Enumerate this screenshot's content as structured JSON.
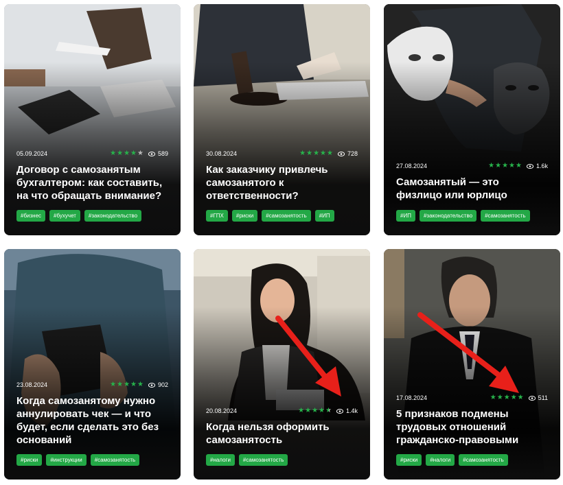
{
  "cards": [
    {
      "date": "05.09.2024",
      "rating": 4,
      "views": "589",
      "title": "Договор с самозанятым бухгалтером: как составить, на что обращать внимание?",
      "tags": [
        "#бизнес",
        "#бухучет",
        "#законодательство"
      ],
      "image": "accountant-calculator-photo"
    },
    {
      "date": "30.08.2024",
      "rating": 5,
      "views": "728",
      "title": "Как заказчику привлечь самозанятого к ответственности?",
      "tags": [
        "#ГПХ",
        "#риски",
        "#самозанятость",
        "#ИП"
      ],
      "image": "judge-gavel-photo"
    },
    {
      "date": "27.08.2024",
      "rating": 5,
      "views": "1.6k",
      "title": "Самозанятый — это физлицо или юрлицо",
      "tags": [
        "#ИП",
        "#законодательство",
        "#самозанятость"
      ],
      "image": "masks-photo"
    },
    {
      "date": "23.08.2024",
      "rating": 5,
      "views": "902",
      "title": "Когда самозанятому нужно аннулировать чек — и что будет, если сделать это без оснований",
      "tags": [
        "#риски",
        "#инструкции",
        "#самозанятость"
      ],
      "image": "phone-hands-photo"
    },
    {
      "date": "20.08.2024",
      "rating": 4.5,
      "views": "1.4k",
      "title": "Когда нельзя оформить самозанятость",
      "tags": [
        "#налоги",
        "#самозанятость"
      ],
      "image": "smiling-woman-photo"
    },
    {
      "date": "17.08.2024",
      "rating": 5,
      "views": "511",
      "title": "5 признаков подмены трудовых отношений гражданско-правовыми",
      "tags": [
        "#риски",
        "#налоги",
        "#самозанятость"
      ],
      "image": "judge-man-photo"
    }
  ],
  "colors": {
    "accent_green": "#23a846",
    "star_green": "#27b34b",
    "arrow_red": "#e8201a"
  }
}
